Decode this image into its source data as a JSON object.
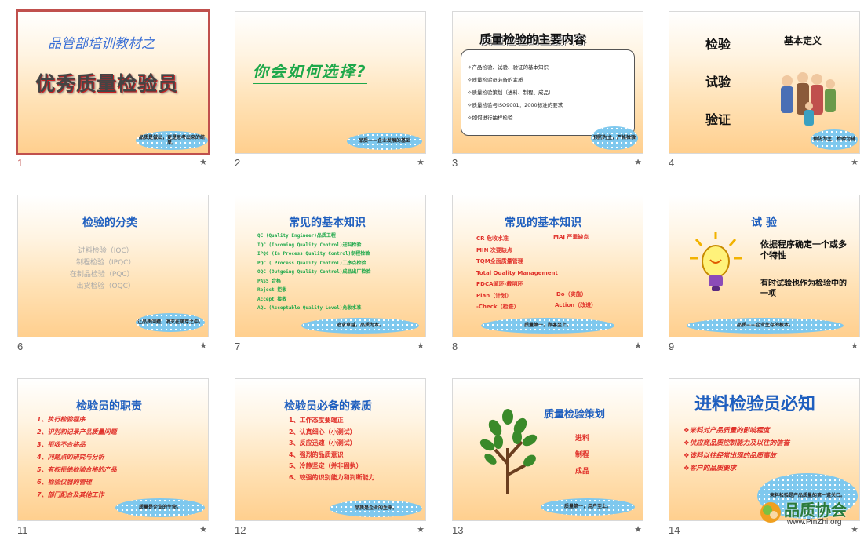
{
  "slides": [
    {
      "number": "1",
      "title": "品管部培训教材之",
      "subtitle": "优秀质量检验员",
      "cloud": "品质是做出，更是思考出来的结果。"
    },
    {
      "number": "2",
      "title": "你会如何选择?",
      "cloud": "品质——企业发展的基础"
    },
    {
      "number": "3",
      "title": "质量检验的主要内容",
      "items": [
        "产品检验、试验、验证的基本知识",
        "质量检验员必备的素质",
        "质量检验策划（进料、制程、成品）",
        "质量检验与ISO9001：2000标准的要求",
        "如何进行抽样检验"
      ],
      "cloud": "预防为主，严格检验"
    },
    {
      "number": "4",
      "words": [
        "检验",
        "试验",
        "验证"
      ],
      "heading": "基本定义",
      "cloud": "预防为主，检验为辅"
    },
    {
      "number": "6",
      "title": "检验的分类",
      "items": [
        "进料检验（IQC）",
        "制程检验（IPQC）",
        "在制品检验（PQC）",
        "出货检验（OQC）"
      ],
      "cloud": "让品质问题，消灭在萌芽之中。"
    },
    {
      "number": "7",
      "title": "常见的基本知识",
      "items": [
        "QE (Quality Engineer)品质工程",
        "IQC (Incoming Quality Control)进料检验",
        "IPQC (In Process Quality Control)制程检验",
        "PQC ( Process Quality Control)工序点检验",
        "OQC (Outgoing Quality Control)成品出厂检验",
        "PASS  合格",
        "Reject  拒收",
        "Accept  接收",
        "AQL (Acceptable Quality Level)允收水准"
      ],
      "cloud": "追求卓越，品质为本。"
    },
    {
      "number": "8",
      "title": "常见的基本知识",
      "left": [
        "CR  危收水准",
        "MIN  次要缺点",
        "TQM全面质量管理",
        "Total Quality Management",
        "PDCA循环-戴明环",
        "Plan（计划）",
        "-Check（检查）"
      ],
      "right": [
        "MAJ  严重缺点",
        "Do（实施）",
        "Action（改进）"
      ],
      "cloud": "质量第一，顾客至上。"
    },
    {
      "number": "9",
      "title": "试  验",
      "text1": "依据程序确定一个或多个特性",
      "text2": "有时试验也作为检验中的一项",
      "cloud": "品质——企业生存的根本。"
    },
    {
      "number": "11",
      "title": "检验员的职责",
      "items": [
        "1、执行检验程序",
        "2、识别和记录产品质量问题",
        "3、拒收不合格品",
        "4、问题点的研究与分析",
        "5、有权拒绝检验合格的产品",
        "6、检验仪器的管理",
        "7、部门配合及其他工作"
      ],
      "cloud": "质量是企业的生命。"
    },
    {
      "number": "12",
      "title": "检验员必备的素质",
      "items": [
        "1、工作态度要端正",
        "2、认真细心（小测试）",
        "3、反应迅速（小测试）",
        "4、强烈的品质意识",
        "5、冷静坚定（并非固执）",
        "6、较强的识别能力和判断能力"
      ],
      "cloud": "品质是企业的生命。"
    },
    {
      "number": "13",
      "title": "质量检验策划",
      "items": [
        "进料",
        "制程",
        "成品"
      ],
      "cloud": "质量第一，用户至上。"
    },
    {
      "number": "14",
      "title": "进料检验员必知",
      "items": [
        "来料对产品质量的影响程度",
        "供应商品质控制能力及以往的信誉",
        "该料以往经常出现的品质事故",
        "客户的品质要求"
      ],
      "cloud": "来料检验是产品质量的第一道关口。"
    }
  ],
  "watermark": {
    "brand": "品质协会",
    "url": "www.PinZhi.org"
  },
  "colors": {
    "accent": "#1f5fbf",
    "red": "#e0312a",
    "green": "#1ea84a",
    "selected": "#c0504d"
  }
}
